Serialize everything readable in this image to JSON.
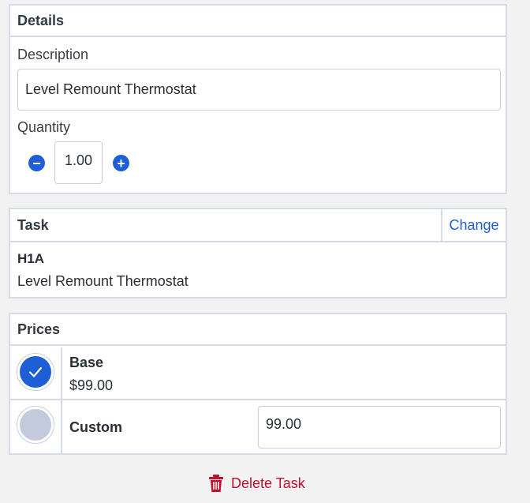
{
  "details": {
    "title": "Details",
    "description_label": "Description",
    "description_value": "Level Remount Thermostat",
    "quantity_label": "Quantity",
    "quantity_value": "1.00",
    "decrement_symbol": "−",
    "increment_symbol": "+"
  },
  "task": {
    "title": "Task",
    "change_label": "Change",
    "code": "H1A",
    "description": "Level Remount Thermostat"
  },
  "prices": {
    "title": "Prices",
    "options": [
      {
        "name": "Base",
        "amount": "$99.00",
        "selected": true
      },
      {
        "name": "Custom",
        "input_value": "99.00",
        "selected": false
      }
    ]
  },
  "actions": {
    "delete_label": "Delete Task"
  },
  "colors": {
    "accent": "#1f5fd6",
    "danger": "#c0102c",
    "border": "#d5dbe8",
    "radio_unselected": "#c2cadb"
  },
  "icons": {
    "minus": "minus-circle-icon",
    "plus": "plus-circle-icon",
    "check": "check-icon",
    "delete": "trash-icon"
  }
}
